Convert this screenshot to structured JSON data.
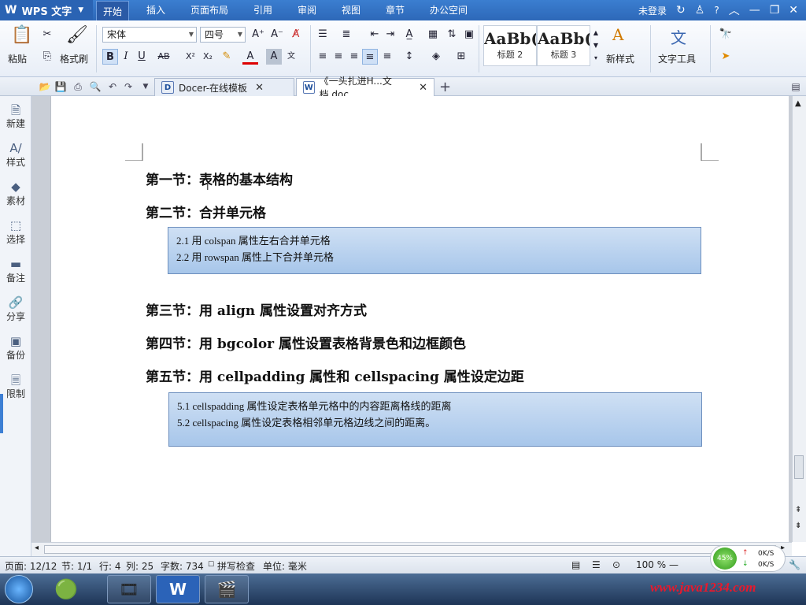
{
  "app": {
    "name": "WPS 文字"
  },
  "menu": [
    "开始",
    "插入",
    "页面布局",
    "引用",
    "审阅",
    "视图",
    "章节",
    "办公空间"
  ],
  "window_controls": {
    "login": "未登录",
    "help": "?"
  },
  "ribbon": {
    "paste": "粘贴",
    "format_painter": "格式刷",
    "font_name": "宋体",
    "font_size": "四号",
    "style1_preview": "AaBb(",
    "style1_label": "标题 2",
    "style2_preview": "AaBb(",
    "style2_label": "标题 3",
    "new_style": "新样式",
    "text_tools": "文字工具"
  },
  "tabs": [
    {
      "label": "Docer-在线模板"
    },
    {
      "label": "《一头扎进H...文档.doc"
    }
  ],
  "sidebar": [
    "新建",
    "样式",
    "素材",
    "选择",
    "备注",
    "分享",
    "备份",
    "限制"
  ],
  "document": {
    "h1": "第一节：表格的基本结构",
    "h2": "第二节：合并单元格",
    "box1": [
      "2.1  用 colspan 属性左右合并单元格",
      "2.2  用 rowspan 属性上下合并单元格"
    ],
    "h3": "第三节：用 align 属性设置对齐方式",
    "h4": "第四节：用 bgcolor 属性设置表格背景色和边框颜色",
    "h5": "第五节：用 cellpadding 属性和 cellspacing 属性设定边距",
    "box2": [
      "5.1 cellspadding 属性设定表格单元格中的内容距离格线的距离",
      "5.2 cellspacing 属性设定表格相邻单元格边线之间的距离。"
    ]
  },
  "status": {
    "page": "页面: 12/12",
    "section": "节: 1/1",
    "row": "行: 4",
    "col": "列: 25",
    "words": "字数: 734",
    "spell": "拼写检查",
    "unit": "单位: 毫米",
    "zoom": "100 %"
  },
  "speed": {
    "percent": "45%",
    "up": "0K/S",
    "down": "0K/S"
  },
  "watermark": "www.java1234.com"
}
